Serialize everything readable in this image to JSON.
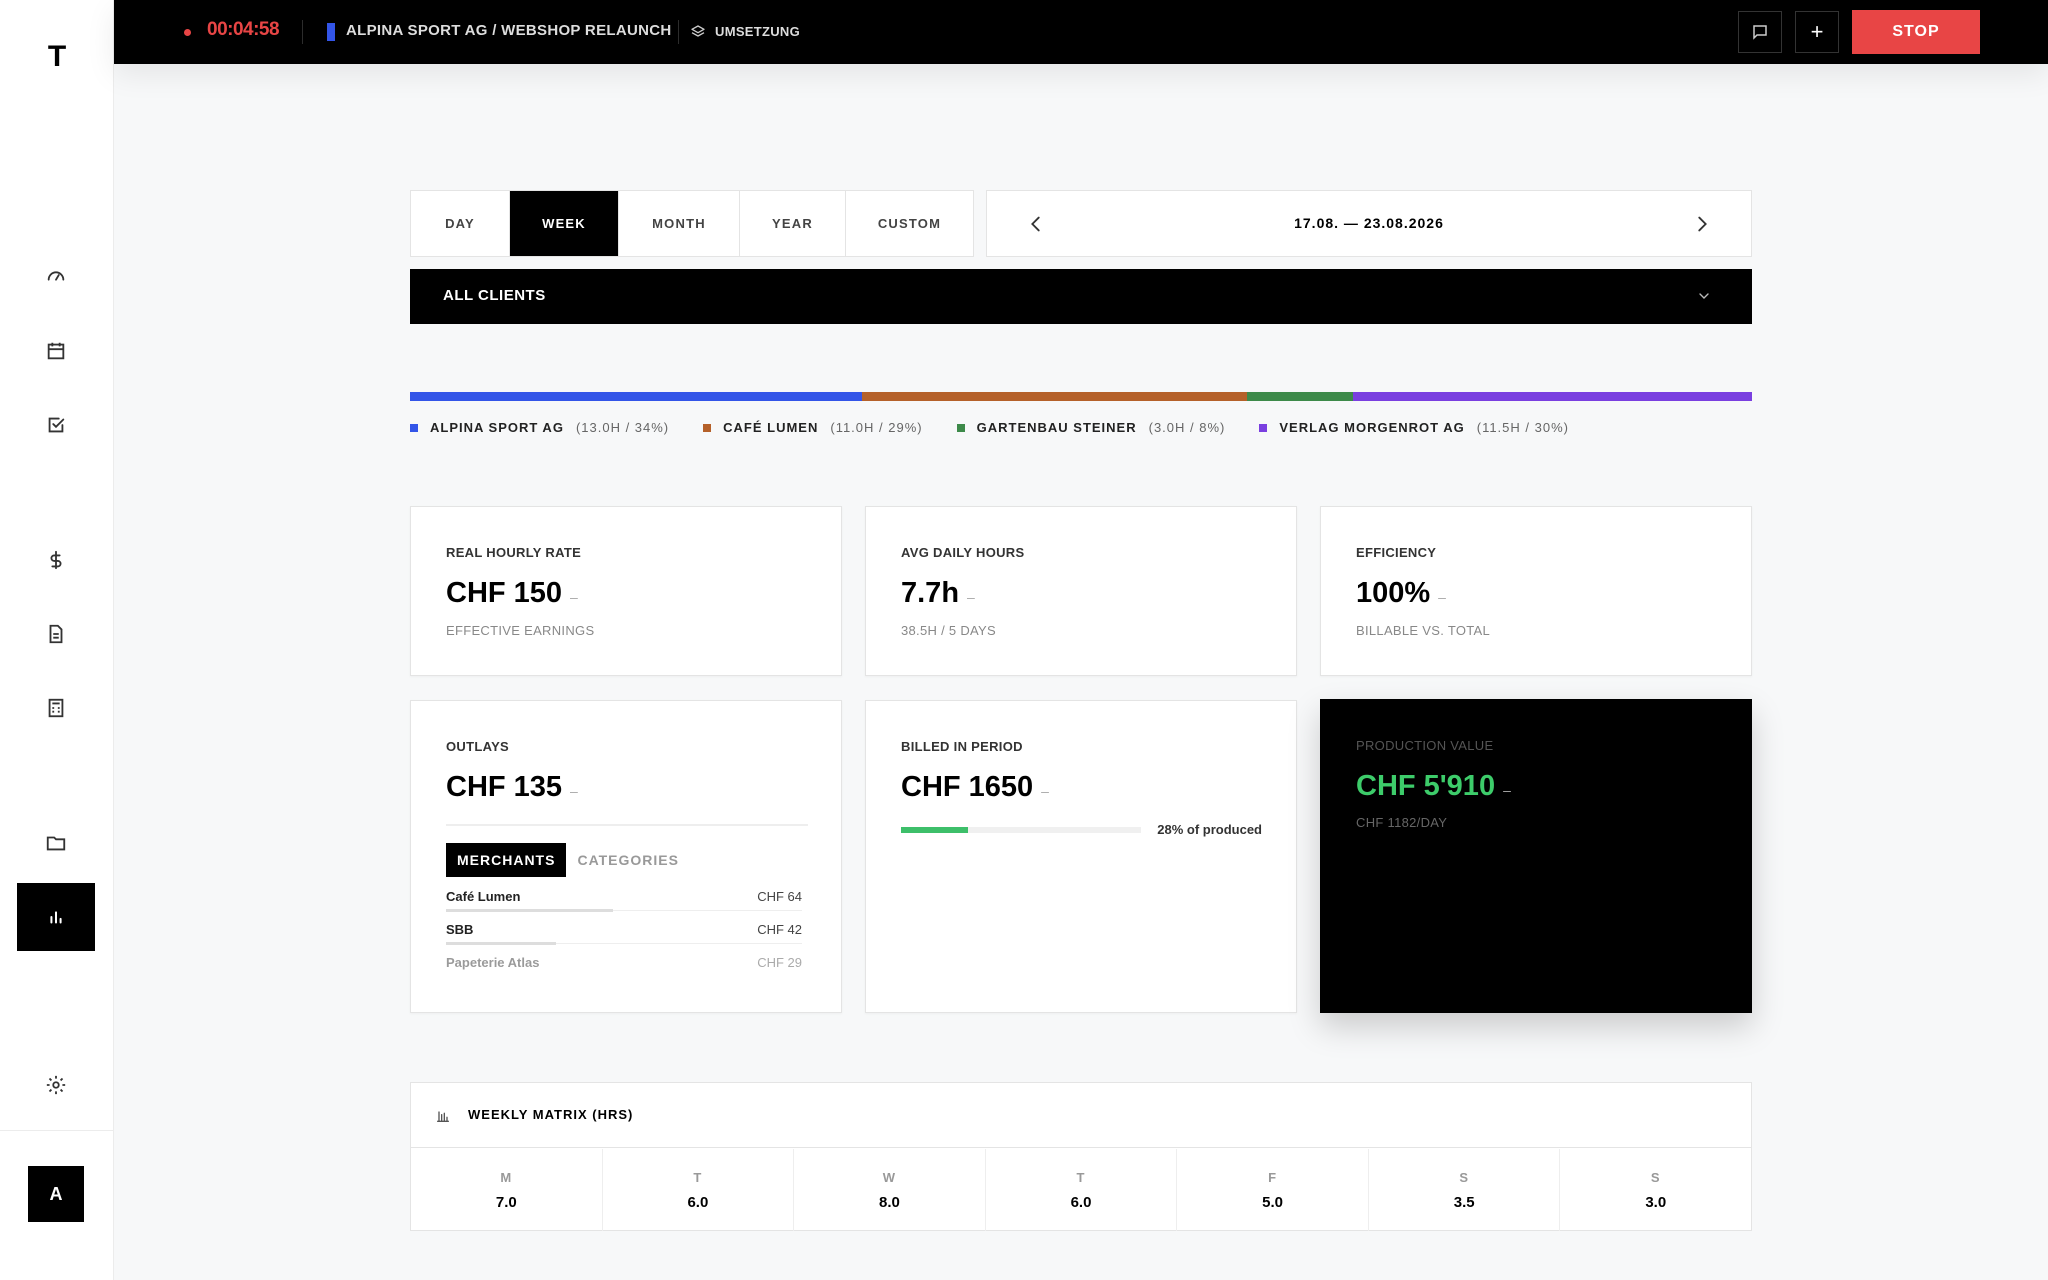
{
  "app": {
    "logo": "T"
  },
  "sidebar": {
    "items": [
      {
        "name": "dashboard-icon"
      },
      {
        "name": "calendar-icon"
      },
      {
        "name": "tasks-icon"
      },
      {
        "name": "dollar-icon"
      },
      {
        "name": "document-icon"
      },
      {
        "name": "calculator-icon"
      },
      {
        "name": "folder-icon"
      },
      {
        "name": "analytics-icon",
        "active": true
      },
      {
        "name": "settings-icon"
      }
    ],
    "avatar": "A"
  },
  "topbar": {
    "timer": "00:04:58",
    "project": "ALPINA SPORT AG / WEBSHOP RELAUNCH",
    "project_color": "#3355e8",
    "phase": "UMSETZUNG",
    "add_label": "+",
    "stop_label": "STOP"
  },
  "period": {
    "tabs": [
      "DAY",
      "WEEK",
      "MONTH",
      "YEAR",
      "CUSTOM"
    ],
    "active": "WEEK",
    "date_range": "17.08. — 23.08.2026"
  },
  "filter": {
    "clients_label": "ALL CLIENTS"
  },
  "distribution": [
    {
      "name": "ALPINA SPORT AG",
      "stat": "(13.0H / 34%)",
      "share": 34,
      "color": "#3355e8"
    },
    {
      "name": "CAFÉ LUMEN",
      "stat": "(11.0H / 29%)",
      "share": 29,
      "color": "#b5612a"
    },
    {
      "name": "GARTENBAU STEINER",
      "stat": "(3.0H / 8%)",
      "share": 8,
      "color": "#3d8a4a"
    },
    {
      "name": "VERLAG MORGENROT AG",
      "stat": "(11.5H / 30%)",
      "share": 30,
      "color": "#7a3fe0"
    }
  ],
  "cards": {
    "rate": {
      "label": "REAL HOURLY RATE",
      "value": "CHF 150",
      "dash": "–",
      "sub": "EFFECTIVE EARNINGS"
    },
    "avg": {
      "label": "AVG DAILY HOURS",
      "value": "7.7h",
      "dash": "–",
      "sub": "38.5H / 5 DAYS"
    },
    "eff": {
      "label": "EFFICIENCY",
      "value": "100%",
      "dash": "–",
      "sub": "BILLABLE VS. TOTAL"
    },
    "outlays": {
      "label": "OUTLAYS",
      "value": "CHF 135",
      "dash": "–",
      "tabs": [
        "MERCHANTS",
        "CATEGORIES"
      ],
      "merchants": [
        {
          "name": "Café Lumen",
          "amount": "CHF 64",
          "share": 0.47
        },
        {
          "name": "SBB",
          "amount": "CHF 42",
          "share": 0.31
        },
        {
          "name": "Papeterie Atlas",
          "amount": "CHF 29",
          "share": 0.21
        }
      ]
    },
    "billed": {
      "label": "BILLED IN PERIOD",
      "value": "CHF 1650",
      "dash": "–",
      "progress": 0.28,
      "note": "28% of produced",
      "color": "#3dbf6a"
    },
    "production": {
      "label": "PRODUCTION VALUE",
      "value": "CHF 5'910",
      "dash": "–",
      "sub": "CHF 1182/DAY",
      "color": "#3dcc6a"
    }
  },
  "matrix": {
    "title": "WEEKLY MATRIX (HRS)",
    "days": [
      {
        "day": "M",
        "hours": "7.0"
      },
      {
        "day": "T",
        "hours": "6.0"
      },
      {
        "day": "W",
        "hours": "8.0"
      },
      {
        "day": "T",
        "hours": "6.0"
      },
      {
        "day": "F",
        "hours": "5.0"
      },
      {
        "day": "S",
        "hours": "3.5"
      },
      {
        "day": "S",
        "hours": "3.0"
      }
    ]
  },
  "colors": {
    "accent": "#e84545",
    "success": "#3dcc6a"
  }
}
